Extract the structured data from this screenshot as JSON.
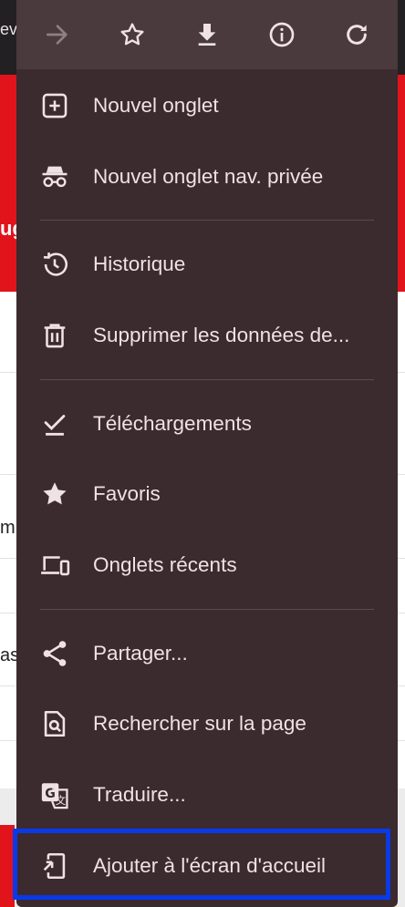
{
  "background": {
    "url_snippet": "ev",
    "red_snippet": "ug",
    "text_snippets": [
      "m",
      "as"
    ]
  },
  "actions": [
    {
      "name": "forward-icon"
    },
    {
      "name": "bookmark-star-icon"
    },
    {
      "name": "download-icon"
    },
    {
      "name": "info-icon"
    },
    {
      "name": "reload-icon"
    }
  ],
  "menu": {
    "new_tab": "Nouvel onglet",
    "incognito": "Nouvel onglet nav. privée",
    "history": "Historique",
    "clear_data": "Supprimer les données de...",
    "downloads": "Téléchargements",
    "bookmarks": "Favoris",
    "recent_tabs": "Onglets récents",
    "share": "Partager...",
    "find_in_page": "Rechercher sur la page",
    "translate": "Traduire...",
    "add_to_home": "Ajouter à l'écran d'accueil"
  },
  "colors": {
    "menu_bg": "#3b2a2e",
    "action_bar_bg": "#4a393d",
    "text": "#efe2e4",
    "highlight": "#0a39e8"
  }
}
